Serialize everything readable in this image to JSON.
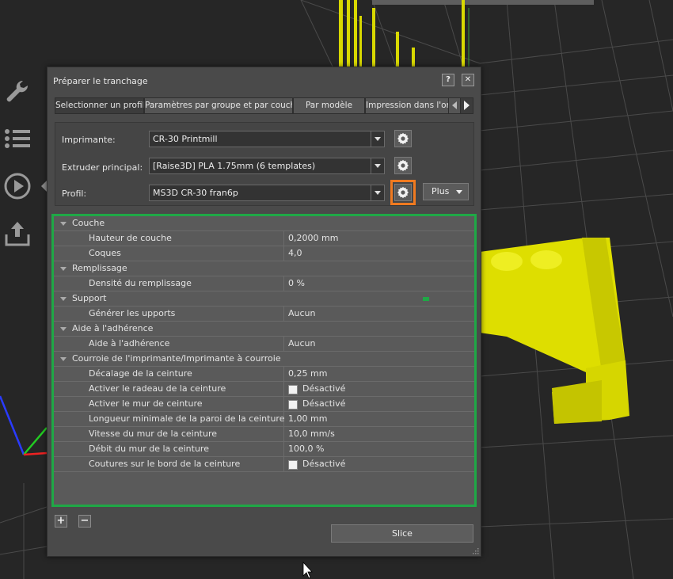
{
  "dialog": {
    "title": "Préparer le tranchage",
    "help_label": "?",
    "close_label": "✕"
  },
  "tabs": [
    {
      "label": "Selectionner un profil",
      "active": true
    },
    {
      "label": "Paramètres par groupe et par couche"
    },
    {
      "label": "Par modèle"
    },
    {
      "label": "Impression dans l'ord"
    }
  ],
  "profile": {
    "printer_label": "Imprimante:",
    "printer_value": "CR-30 Printmill",
    "extruder_label": "Extruder principal:",
    "extruder_value": "[Raise3D] PLA 1.75mm (6 templates)",
    "profile_label": "Profil:",
    "profile_value": "MS3D CR-30 fran6p",
    "more_label": "Plus"
  },
  "settings": [
    {
      "type": "cat",
      "name": "Couche"
    },
    {
      "type": "item",
      "name": "Hauteur de couche",
      "value": "0,2000 mm"
    },
    {
      "type": "item",
      "name": "Coques",
      "value": "4,0"
    },
    {
      "type": "cat",
      "name": "Remplissage"
    },
    {
      "type": "item",
      "name": "Densité du remplissage",
      "value": "0 %"
    },
    {
      "type": "cat",
      "name": "Support"
    },
    {
      "type": "item",
      "name": "Générer les upports",
      "value": "Aucun"
    },
    {
      "type": "cat",
      "name": "Aide à l'adhérence"
    },
    {
      "type": "item",
      "name": "Aide à l'adhérence",
      "value": "Aucun"
    },
    {
      "type": "cat",
      "name": "Courroie de l'imprimante/Imprimante à courroie"
    },
    {
      "type": "item",
      "name": "Décalage de la ceinture",
      "value": "0,25 mm"
    },
    {
      "type": "check",
      "name": "Activer le radeau de la ceinture",
      "value": "Désactivé"
    },
    {
      "type": "check",
      "name": "Activer le mur de ceinture",
      "value": "Désactivé"
    },
    {
      "type": "item",
      "name": "Longueur minimale de la paroi de la ceinture",
      "value": "1,00 mm"
    },
    {
      "type": "item",
      "name": "Vitesse du mur de la ceinture",
      "value": "10,0 mm/s"
    },
    {
      "type": "item",
      "name": "Débit du mur de la ceinture",
      "value": "100,0 %"
    },
    {
      "type": "check",
      "name": "Coutures sur le bord de la ceinture",
      "value": "Désactivé"
    }
  ],
  "footer": {
    "add_label": "+",
    "remove_label": "−",
    "slice_label": "Slice"
  },
  "colors": {
    "highlight_orange": "#f07a20",
    "highlight_green": "#1fa846",
    "model_yellow": "#e6e600"
  },
  "toolbar": {
    "icons": [
      "wrench-icon",
      "list-icon",
      "play-icon",
      "upload-icon"
    ]
  }
}
